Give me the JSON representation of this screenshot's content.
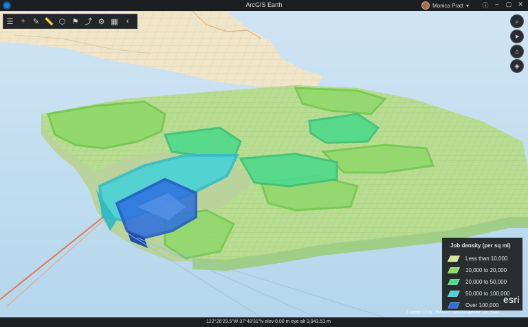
{
  "window": {
    "title": "ArcGIS Earth",
    "user_name": "Monica Pratt"
  },
  "toolbar": {
    "tools": [
      {
        "icon": "list-icon"
      },
      {
        "icon": "add-icon"
      },
      {
        "icon": "draw-icon"
      },
      {
        "icon": "measure-icon"
      },
      {
        "icon": "cube-icon"
      },
      {
        "icon": "bookmark-icon"
      },
      {
        "icon": "share-icon"
      },
      {
        "icon": "settings-icon"
      },
      {
        "icon": "apps-icon"
      },
      {
        "icon": "collapse-icon"
      }
    ]
  },
  "map_controls": [
    "search-icon",
    "navigate-icon",
    "home-icon",
    "layers-icon"
  ],
  "legend": {
    "title": "Job density (per sq mi)",
    "items": [
      {
        "label": "Less than 10,000",
        "color": "#d4e79a"
      },
      {
        "label": "10,000 to 20,000",
        "color": "#8fd86a"
      },
      {
        "label": "20,000 to 50,000",
        "color": "#4fd98a"
      },
      {
        "label": "50,000 to 100,000",
        "color": "#4ad2d8"
      },
      {
        "label": "Over 100,000",
        "color": "#2d6fe0"
      }
    ]
  },
  "branding": {
    "esri": "esri",
    "attribution": "Copyright © City... Bureau of Land Management, Esri, HERE"
  },
  "status": {
    "coordinates": "122°26'29.5\"W 37°49'31\"N  elev 0.00 m  eye alt 3,943.51 m"
  },
  "colors": {
    "water": "#bedcf0",
    "land": "#f1e7cd",
    "accent": "#1e7fd6"
  }
}
